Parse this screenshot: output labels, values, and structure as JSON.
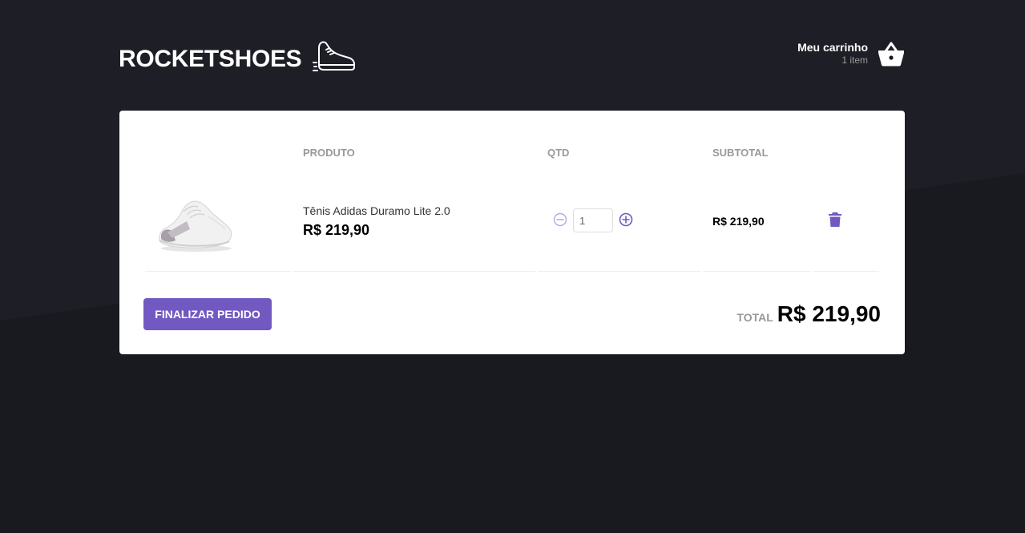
{
  "brand": {
    "name": "ROCKETSHOES",
    "logo_icon": "running-shoe-icon"
  },
  "header": {
    "cart_title": "Meu carrinho",
    "cart_count": "1 item",
    "cart_icon": "basket-icon"
  },
  "table": {
    "headers": {
      "product": "PRODUTO",
      "qty": "QTD",
      "subtotal": "SUBTOTAL"
    },
    "rows": [
      {
        "title": "Tênis Adidas Duramo Lite 2.0",
        "price": "R$ 219,90",
        "quantity": "1",
        "subtotal": "R$ 219,90",
        "image_icon": "sneaker-image",
        "decrement_icon": "minus-circle-icon",
        "increment_icon": "plus-circle-icon",
        "delete_icon": "trash-icon"
      }
    ]
  },
  "footer": {
    "checkout_label": "FINALIZAR PEDIDO",
    "total_label": "TOTAL",
    "total_value": "R$ 219,90"
  },
  "colors": {
    "background": "#191920",
    "background_light": "#1e1e26",
    "accent": "#7159c1",
    "card": "#ffffff",
    "header_text": "#999999"
  }
}
